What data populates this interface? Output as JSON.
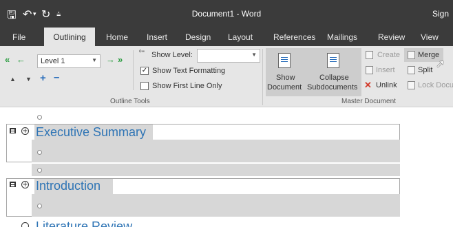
{
  "titlebar": {
    "doc_title": "Document1 - Word",
    "sign_in": "Sign"
  },
  "tabs": [
    "File",
    "Outlining",
    "Home",
    "Insert",
    "Design",
    "Layout",
    "References",
    "Mailings",
    "Review",
    "View"
  ],
  "active_tab": "Outlining",
  "outline_tools": {
    "level": "Level 1",
    "show_level_label": "Show Level:",
    "show_level_value": "",
    "show_text_formatting_label": "Show Text Formatting",
    "show_text_formatting_checked": true,
    "show_first_line_only_label": "Show First Line Only",
    "show_first_line_only_checked": false,
    "group_label": "Outline Tools"
  },
  "master_document": {
    "show_document_line1": "Show",
    "show_document_line2": "Document",
    "collapse_line1": "Collapse",
    "collapse_line2": "Subdocuments",
    "create": "Create",
    "insert": "Insert",
    "unlink": "Unlink",
    "merge": "Merge",
    "split": "Split",
    "lock_document": "Lock Docu",
    "group_label": "Master Document"
  },
  "outline": {
    "heading1": "Executive Summary",
    "heading2": "Introduction",
    "heading3": "Literature Review"
  },
  "colors": {
    "titlebar": "#3b3b3b",
    "ribbon": "#e6e6e6",
    "heading": "#2e74b5",
    "highlight": "#d7d7d7"
  }
}
